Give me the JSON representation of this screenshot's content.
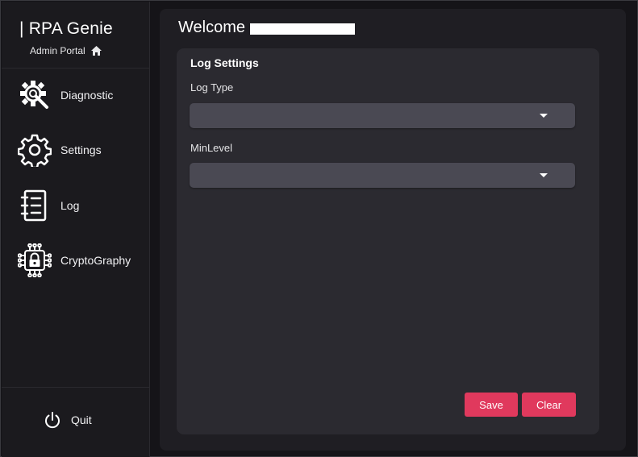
{
  "sidebar": {
    "brand": "| RPA Genie",
    "subtitle": "Admin Portal",
    "items": [
      {
        "label": "Diagnostic",
        "icon": "gear-wrench-icon"
      },
      {
        "label": "Settings",
        "icon": "gear-icon"
      },
      {
        "label": "Log",
        "icon": "notebook-icon"
      },
      {
        "label": "CryptoGraphy",
        "icon": "circuit-lock-icon"
      }
    ],
    "quit_label": "Quit",
    "quit_icon": "power-icon"
  },
  "main": {
    "welcome": "Welcome",
    "card": {
      "title": "Log Settings",
      "fields": [
        {
          "label": "Log Type",
          "value": ""
        },
        {
          "label": "MinLevel",
          "value": ""
        }
      ],
      "save_label": "Save",
      "clear_label": "Clear"
    }
  },
  "colors": {
    "accent": "#e0395d",
    "background": "#151418",
    "sidebar": "#1b1a1e",
    "card": "#2b2a30",
    "input": "#4a4953"
  }
}
